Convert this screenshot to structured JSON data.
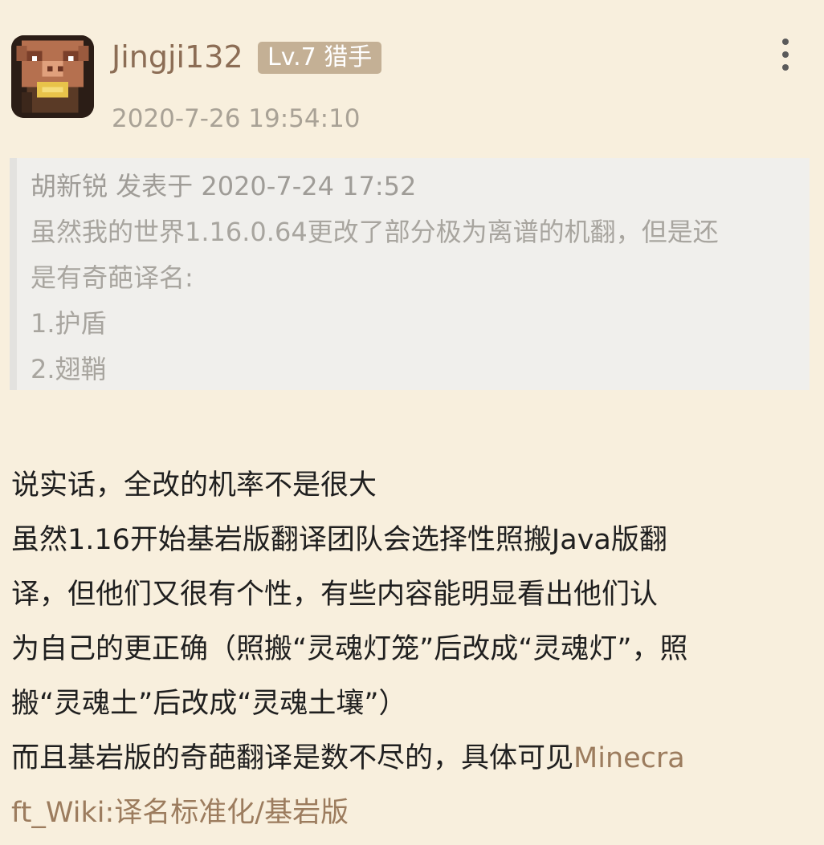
{
  "post": {
    "username": "Jingji132",
    "level_badge": "Lv.7 猎手",
    "timestamp": "2020-7-26 19:54:10"
  },
  "quote": {
    "header": "胡新锐 发表于 2020-7-24 17:52",
    "lines": [
      "虽然我的世界1.16.0.64更改了部分极为离谱的机翻，但是还",
      "是有奇葩译名:",
      "1.护盾",
      "2.翅鞘"
    ]
  },
  "body": {
    "lines": [
      "说实话，全改的机率不是很大",
      "虽然1.16开始基岩版翻译团队会选择性照搬Java版翻",
      "译，但他们又很有个性，有些内容能明显看出他们认",
      "为自己的更正确（照搬“灵魂灯笼”后改成“灵魂灯”，照",
      "搬“灵魂土”后改成“灵魂土壤”）"
    ],
    "last_line_prefix": "而且基岩版的奇葩翻译是数不尽的，具体可见",
    "link_part1": "Minecra",
    "link_part2": "ft_Wiki:译名标准化/基岩版"
  },
  "icons": {
    "avatar": "piglin-avatar",
    "more": "more-vertical-icon"
  },
  "colors": {
    "background": "#f8efdd",
    "username": "#8c6d55",
    "badge": "#c4b095",
    "link": "#9c7c5e",
    "quote_bg": "#f0efec"
  }
}
